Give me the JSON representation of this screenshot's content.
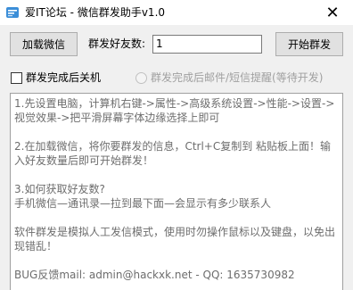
{
  "window": {
    "title": "爱IT论坛 - 微信群发助手v1.0",
    "close_glyph": "✕"
  },
  "toolbar": {
    "load_button_label": "加载微信",
    "count_label": "群发好友数:",
    "count_value": "1",
    "start_button_label": "开始群发"
  },
  "options": {
    "shutdown_label": "群发完成后关机",
    "shutdown_checked": false,
    "notify_label": "群发完成后邮件/短信提醒(等待开发)",
    "notify_enabled": false
  },
  "instructions": {
    "p1": "1.先设置电脑，计算机右键->属性->高级系统设置->性能->设置->视觉效果->把平滑屏幕字体边缘选择上即可",
    "p2": "2.在加载微信，将你要群发的信息，Ctrl+C复制到 粘贴板上面！输入好友数量后即可开始群发！",
    "p3": "3.如何获取好友数?\n手机微信—通讯录—拉到最下面—会显示有多少联系人",
    "p4": "软件群发是模拟人工发信模式，使用时勿操作鼠标以及键盘，以免出现错乱！",
    "p5": "BUG反馈mail: admin@hackxk.net - QQ: 1635730982"
  },
  "colors": {
    "window_bg": "#f0f0f0",
    "titlebar_bg": "#ffffff",
    "button_bg": "#e1e1e1",
    "info_text": "#6d6d6d",
    "disabled_text": "#a0a0a0"
  }
}
